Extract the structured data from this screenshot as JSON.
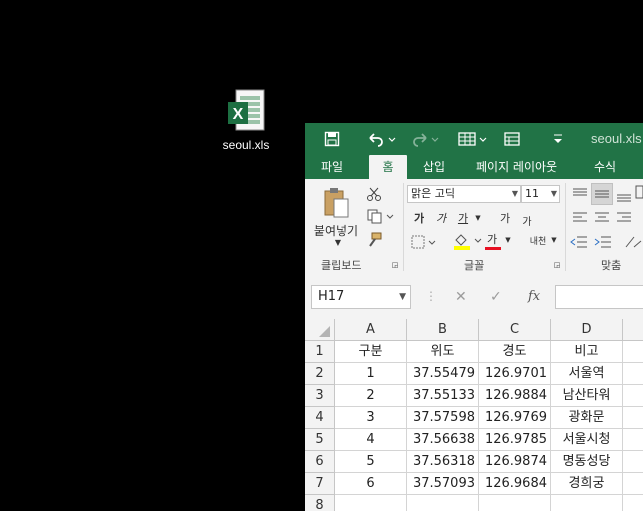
{
  "desktop": {
    "file_label": "seoul.xls"
  },
  "window": {
    "title": "seoul.xls",
    "accent": "#217346",
    "qa_icons": [
      "save-icon",
      "undo-icon",
      "redo-icon",
      "form-icon",
      "table-icon",
      "customize-icon"
    ],
    "tabs": [
      "파일",
      "홈",
      "삽입",
      "페이지 레이아웃",
      "수식"
    ],
    "active_tab": "홈"
  },
  "ribbon": {
    "clipboard": {
      "paste_label": "붙여넣기",
      "group_label": "클립보드"
    },
    "font": {
      "font_name": "맑은 고딕",
      "font_size": "11",
      "bold": "가",
      "italic": "가",
      "underline": "가",
      "grow": "가",
      "shrink": "가",
      "font_color_glyph": "가",
      "phonetic": "내천",
      "group_label": "글꼴"
    },
    "alignment": {
      "group_label": "맞춤"
    }
  },
  "formula_bar": {
    "name_box": "H17",
    "fx": "fx",
    "value": ""
  },
  "sheet": {
    "columns": [
      "A",
      "B",
      "C",
      "D"
    ],
    "rows": [
      {
        "num": "1",
        "cells": [
          "구분",
          "위도",
          "경도",
          "비고"
        ]
      },
      {
        "num": "2",
        "cells": [
          "1",
          "37.55479",
          "126.9701",
          "서울역"
        ]
      },
      {
        "num": "3",
        "cells": [
          "2",
          "37.55133",
          "126.9884",
          "남산타워"
        ]
      },
      {
        "num": "4",
        "cells": [
          "3",
          "37.57598",
          "126.9769",
          "광화문"
        ]
      },
      {
        "num": "5",
        "cells": [
          "4",
          "37.56638",
          "126.9785",
          "서울시청"
        ]
      },
      {
        "num": "6",
        "cells": [
          "5",
          "37.56318",
          "126.9874",
          "명동성당"
        ]
      },
      {
        "num": "7",
        "cells": [
          "6",
          "37.57093",
          "126.9684",
          "경희궁"
        ]
      },
      {
        "num": "8",
        "cells": [
          "",
          "",
          "",
          ""
        ]
      }
    ]
  }
}
